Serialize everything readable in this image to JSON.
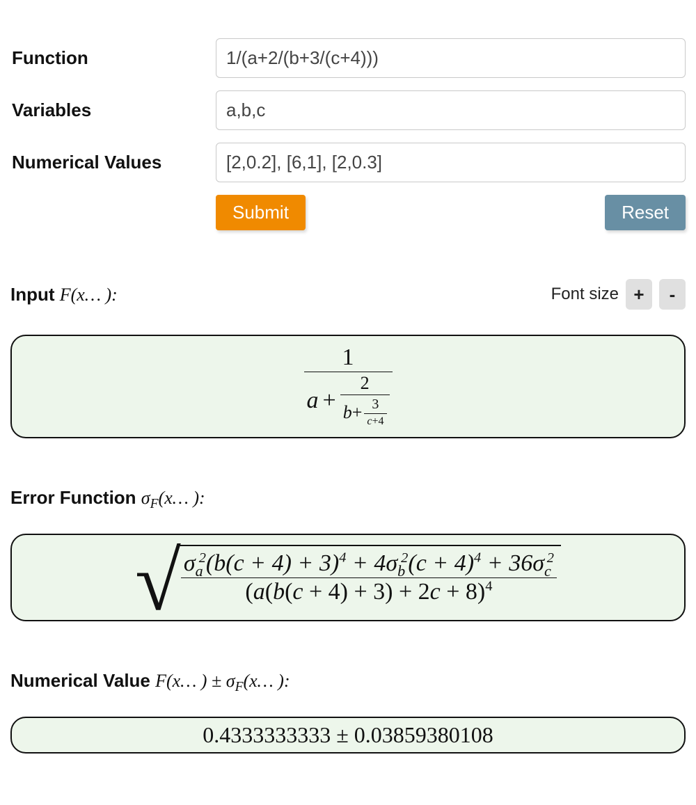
{
  "form": {
    "function_label": "Function",
    "function_value": "1/(a+2/(b+3/(c+4)))",
    "variables_label": "Variables",
    "variables_value": "a,b,c",
    "numvalues_label": "Numerical Values",
    "numvalues_value": "[2,0.2], [6,1], [2,0.3]",
    "submit": "Submit",
    "reset": "Reset"
  },
  "fontsize": {
    "label": "Font size",
    "plus": "+",
    "minus": "-"
  },
  "sections": {
    "input_prefix": "Input ",
    "input_math": "F(x… ):",
    "error_prefix": "Error Function ",
    "error_math": "σ",
    "error_math2": "F",
    "error_math3": "(x… ):",
    "numval_prefix": "Numerical Value ",
    "numval_math": "F(x… ) ± σ",
    "numval_math2": "F",
    "numval_math3": "(x… ):"
  },
  "box1": {
    "num_top": "1",
    "a": "a",
    "plus1": " + ",
    "two": "2",
    "b": "b",
    "plus2": "+",
    "three": "3",
    "c": "c",
    "plus3": "+",
    "four": "4"
  },
  "box2": {
    "numerator_html": "σ<sub>a</sub><sup style=\"margin-left:-6px\">2</sup>(<span class=\"math-ital\">b</span>(<span class=\"math-ital\">c</span> + 4) + 3)<sup>4</sup> + 4σ<sub>b</sub><sup style=\"margin-left:-6px\">2</sup>(<span class=\"math-ital\">c</span> + 4)<sup>4</sup> + 36σ<sub>c</sub><sup style=\"margin-left:-6px\">2</sup>",
    "denominator_html": "(<span class=\"math-ital\">a</span>(<span class=\"math-ital\">b</span>(<span class=\"math-ital\">c</span> + 4) + 3) + 2<span class=\"math-ital\">c</span> + 8)<sup>4</sup>"
  },
  "box3": {
    "value": "0.4333333333",
    "pm": " ± ",
    "sigma": "0.03859380108"
  }
}
